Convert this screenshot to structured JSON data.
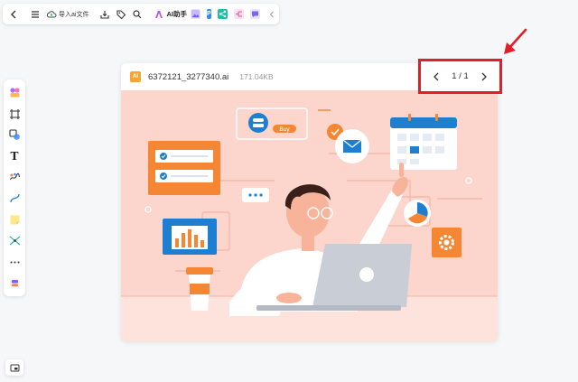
{
  "toolbar": {
    "import_label": "导入ai文件",
    "ai_label": "AI助手",
    "p_label": "P"
  },
  "viewer": {
    "file_type": "AI",
    "file_name": "6372121_3277340.ai",
    "file_size": "171.04KB",
    "page_indicator": "1 / 1"
  },
  "illustration": {
    "buy_label": "Buy"
  },
  "colors": {
    "accent_red": "#e41e26",
    "illustration_bg": "#fcd5cc",
    "orange": "#f58634",
    "blue": "#1e7fd1"
  }
}
